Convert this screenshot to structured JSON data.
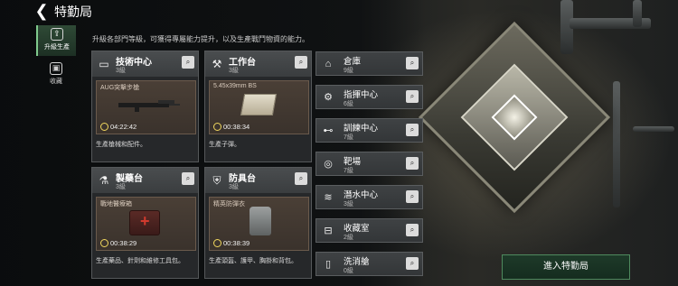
{
  "header": {
    "back_icon": "back-arrow-icon",
    "title": "特勤局"
  },
  "subtitle": "升級各部門等級，可獲得專屬能力提升，以及生產戰鬥物資的能力。",
  "sidebar": [
    {
      "label": "升級生產",
      "icon": "upgrade-icon",
      "active": true
    },
    {
      "label": "收藏",
      "icon": "collection-icon",
      "active": false
    }
  ],
  "cards": [
    {
      "name": "技術中心",
      "level": "3級",
      "icon": "computer-icon",
      "product": "AUG突擊步槍",
      "timer": "04:22:42",
      "desc": "生產槍械和配件。"
    },
    {
      "name": "工作台",
      "level": "3級",
      "icon": "tools-icon",
      "product": "5.45x39mm BS",
      "timer": "00:38:34",
      "desc": "生產子彈。"
    },
    {
      "name": "製藥台",
      "level": "3級",
      "icon": "flask-icon",
      "product": "戰地醫療箱",
      "timer": "00:38:29",
      "desc": "生產藥品、針劑和維修工具包。"
    },
    {
      "name": "防具台",
      "level": "3級",
      "icon": "armor-icon",
      "product": "精英防彈衣",
      "timer": "00:38:39",
      "desc": "生產頭盔、護甲、胸掛和背包。"
    }
  ],
  "rows": [
    {
      "name": "倉庫",
      "level": "9級",
      "icon": "storage-icon"
    },
    {
      "name": "指揮中心",
      "level": "6級",
      "icon": "gear-icon"
    },
    {
      "name": "訓練中心",
      "level": "7級",
      "icon": "dumbbell-icon"
    },
    {
      "name": "靶場",
      "level": "7級",
      "icon": "target-icon"
    },
    {
      "name": "潛水中心",
      "level": "3級",
      "icon": "dive-icon"
    },
    {
      "name": "收藏室",
      "level": "2級",
      "icon": "display-case-icon"
    },
    {
      "name": "洗消艙",
      "level": "0級",
      "icon": "decon-icon"
    }
  ],
  "enter_button": "進入特勤局",
  "colors": {
    "accent": "#7fc98c",
    "card_bg": "#2a2c2e",
    "product_bg": "#4a3f36",
    "timer_ring": "#f0d75e"
  }
}
